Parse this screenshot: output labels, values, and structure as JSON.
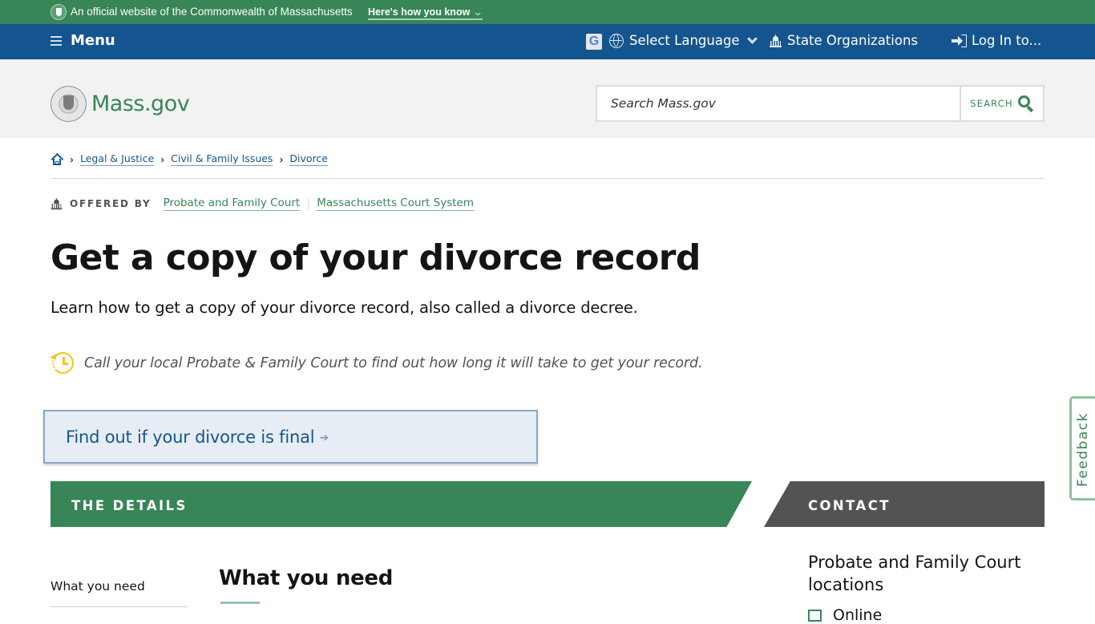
{
  "official_bar": {
    "text": "An official website of the Commonwealth of Massachusetts",
    "how_link": "Here's how you know",
    "chevron": "⌄"
  },
  "nav": {
    "menu_label": "Menu",
    "google_icon_letter": "G",
    "language_label": "Select Language",
    "orgs_label": "State Organizations",
    "login_label": "Log In to..."
  },
  "header": {
    "brand": "Mass.gov",
    "search_placeholder": "Search Mass.gov",
    "search_button": "SEARCH"
  },
  "breadcrumb": {
    "separator": "›",
    "items": [
      "Legal & Justice",
      "Civil & Family Issues",
      "Divorce"
    ]
  },
  "offered_by": {
    "label": "OFFERED BY",
    "orgs": [
      "Probate and Family Court",
      "Massachusetts Court System"
    ]
  },
  "page": {
    "title": "Get a copy of your divorce record",
    "lede": "Learn how to get a copy of your divorce record, also called a divorce decree.",
    "notice": "Call your local Probate & Family Court to find out how long it will take to get your record.",
    "callout": "Find out if your divorce is final",
    "callout_arrow": "➔"
  },
  "sections": {
    "details_header": "THE DETAILS",
    "contact_header": "CONTACT",
    "toc": [
      "What you need"
    ],
    "first_heading": "What you need"
  },
  "contact": {
    "title": "Probate and Family Court locations",
    "items": [
      "Online"
    ]
  },
  "feedback": {
    "label": "Feedback"
  },
  "colors": {
    "brand_green": "#388557",
    "nav_blue": "#14558f",
    "contact_gray": "#535353",
    "notice_yellow": "#f6c51b"
  }
}
